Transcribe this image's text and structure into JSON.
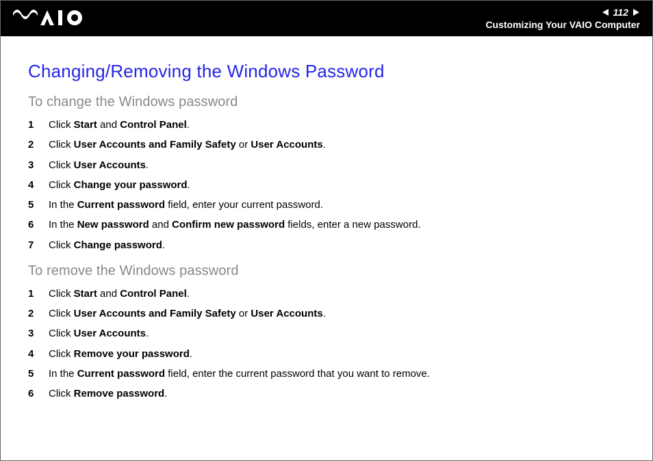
{
  "header": {
    "page_number": "112",
    "breadcrumb": "Customizing Your VAIO Computer"
  },
  "title": "Changing/Removing the Windows Password",
  "sections": [
    {
      "subtitle": "To change the Windows password",
      "steps": [
        "Click <b>Start</b> and <b>Control Panel</b>.",
        "Click <b>User Accounts and Family Safety</b> or <b>User Accounts</b>.",
        "Click <b>User Accounts</b>.",
        "Click <b>Change your password</b>.",
        "In the <b>Current password</b> field, enter your current password.",
        "In the <b>New password</b> and <b>Confirm new password</b> fields, enter a new password.",
        "Click <b>Change password</b>."
      ]
    },
    {
      "subtitle": "To remove the Windows password",
      "steps": [
        "Click <b>Start</b> and <b>Control Panel</b>.",
        "Click <b>User Accounts and Family Safety</b> or <b>User Accounts</b>.",
        "Click <b>User Accounts</b>.",
        "Click <b>Remove your password</b>.",
        "In the <b>Current password</b> field, enter the current password that you want to remove.",
        "Click <b>Remove password</b>."
      ]
    }
  ]
}
